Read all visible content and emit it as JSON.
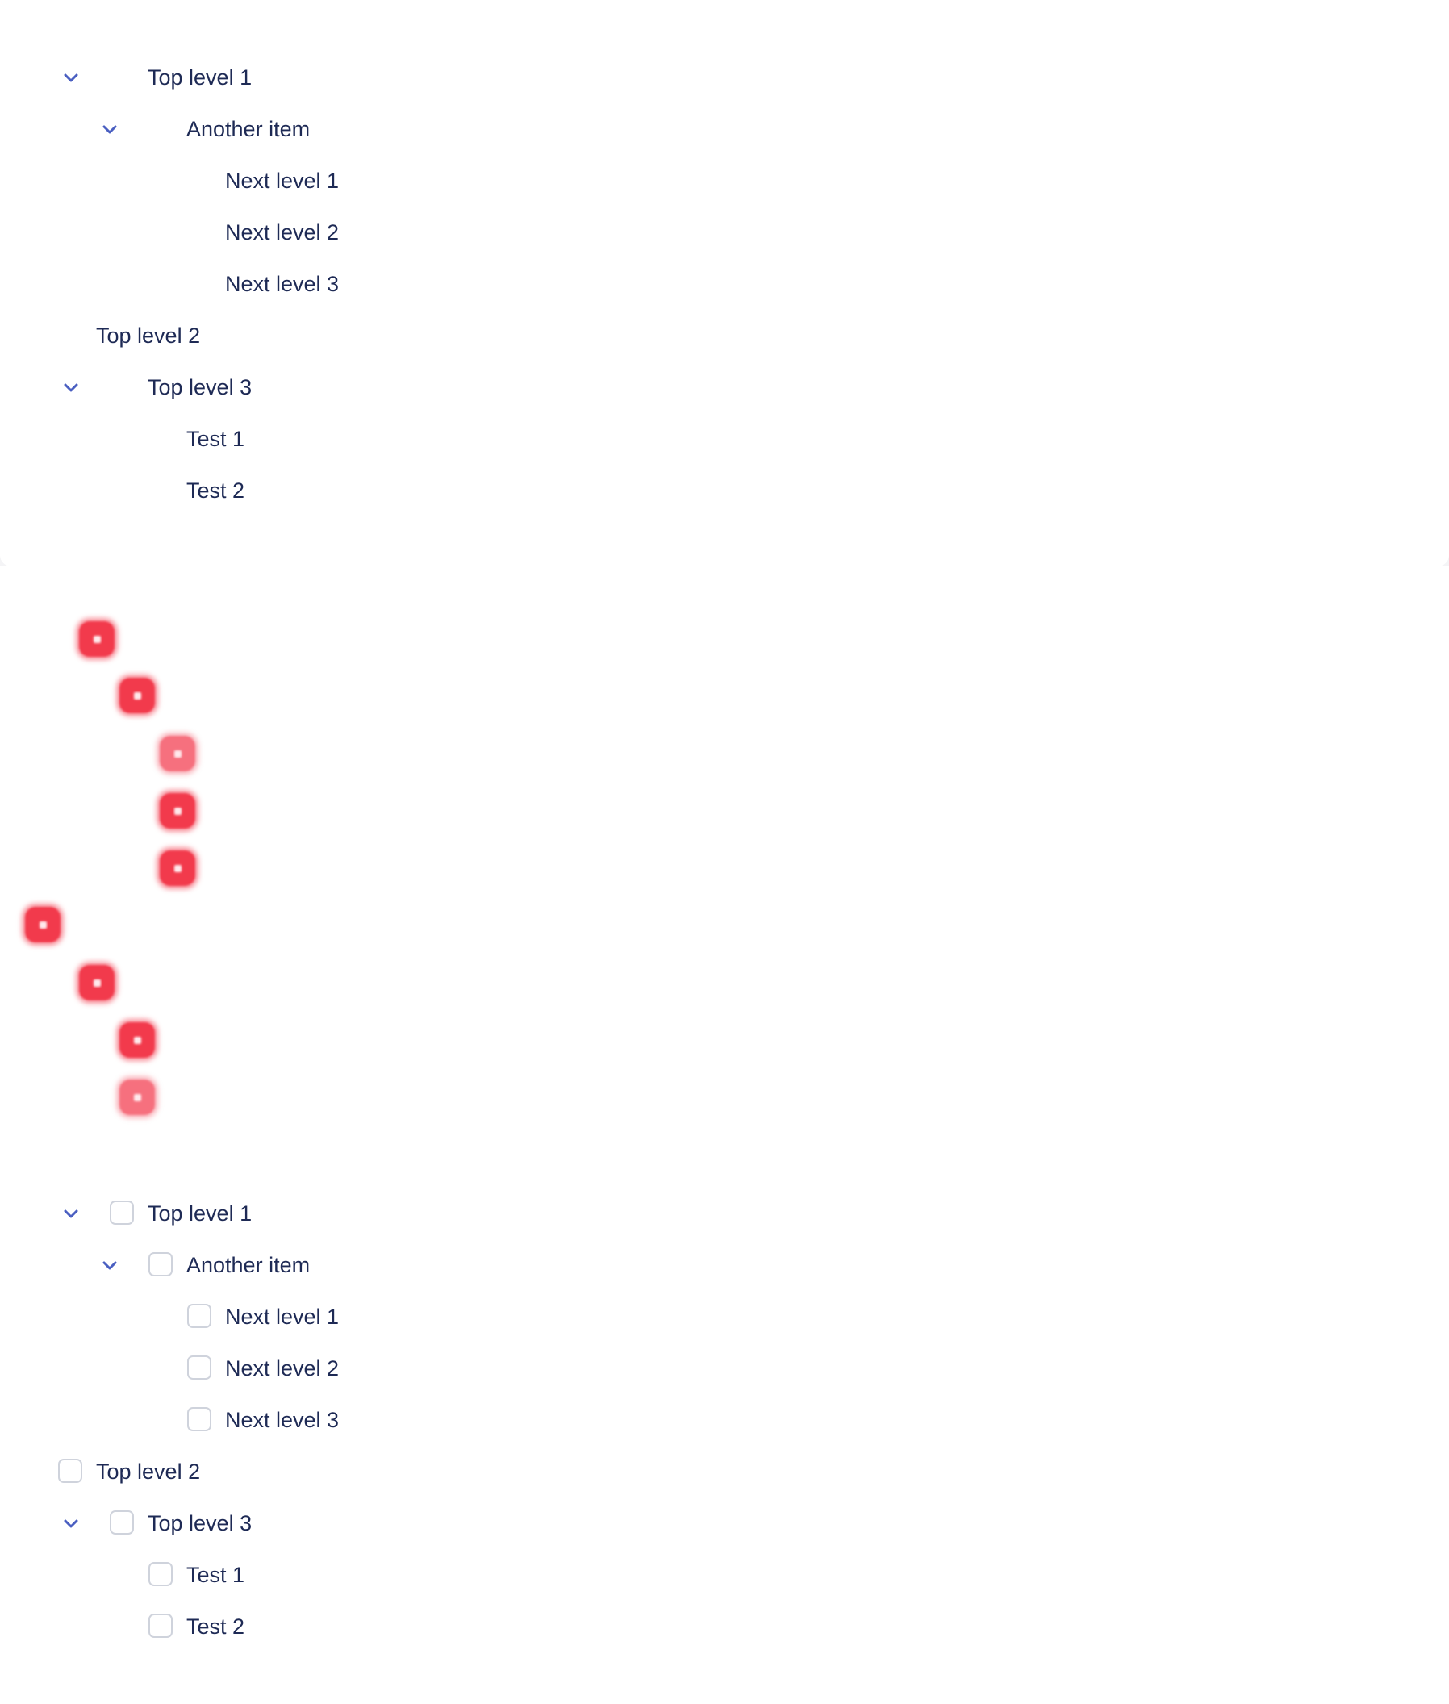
{
  "tree_plain": {
    "items": [
      {
        "label": "Top level 1",
        "expanded": true
      },
      {
        "label": "Another item",
        "expanded": true
      },
      {
        "label": "Next level 1"
      },
      {
        "label": "Next level 2"
      },
      {
        "label": "Next level 3"
      },
      {
        "label": "Top level 2"
      },
      {
        "label": "Top level 3",
        "expanded": true
      },
      {
        "label": "Test 1"
      },
      {
        "label": "Test 2"
      }
    ]
  },
  "tree_checkbox": {
    "items": [
      {
        "label": "Top level 1",
        "expanded": true,
        "checked": false
      },
      {
        "label": "Another item",
        "expanded": true,
        "checked": false
      },
      {
        "label": "Next level 1",
        "checked": false
      },
      {
        "label": "Next level 2",
        "checked": false
      },
      {
        "label": "Next level 3",
        "checked": false
      },
      {
        "label": "Top level 2",
        "checked": false
      },
      {
        "label": "Top level 3",
        "expanded": true,
        "checked": false
      },
      {
        "label": "Test 1",
        "checked": false
      },
      {
        "label": "Test 2",
        "checked": false
      }
    ]
  },
  "colors": {
    "text": "#1e2a55",
    "chevron": "#4a5fc1",
    "marker": "#f23a4c",
    "checkbox_border": "#cfd3dc"
  },
  "icons": {
    "expand": "chevron-down-icon",
    "marker": "red-marker-icon"
  }
}
